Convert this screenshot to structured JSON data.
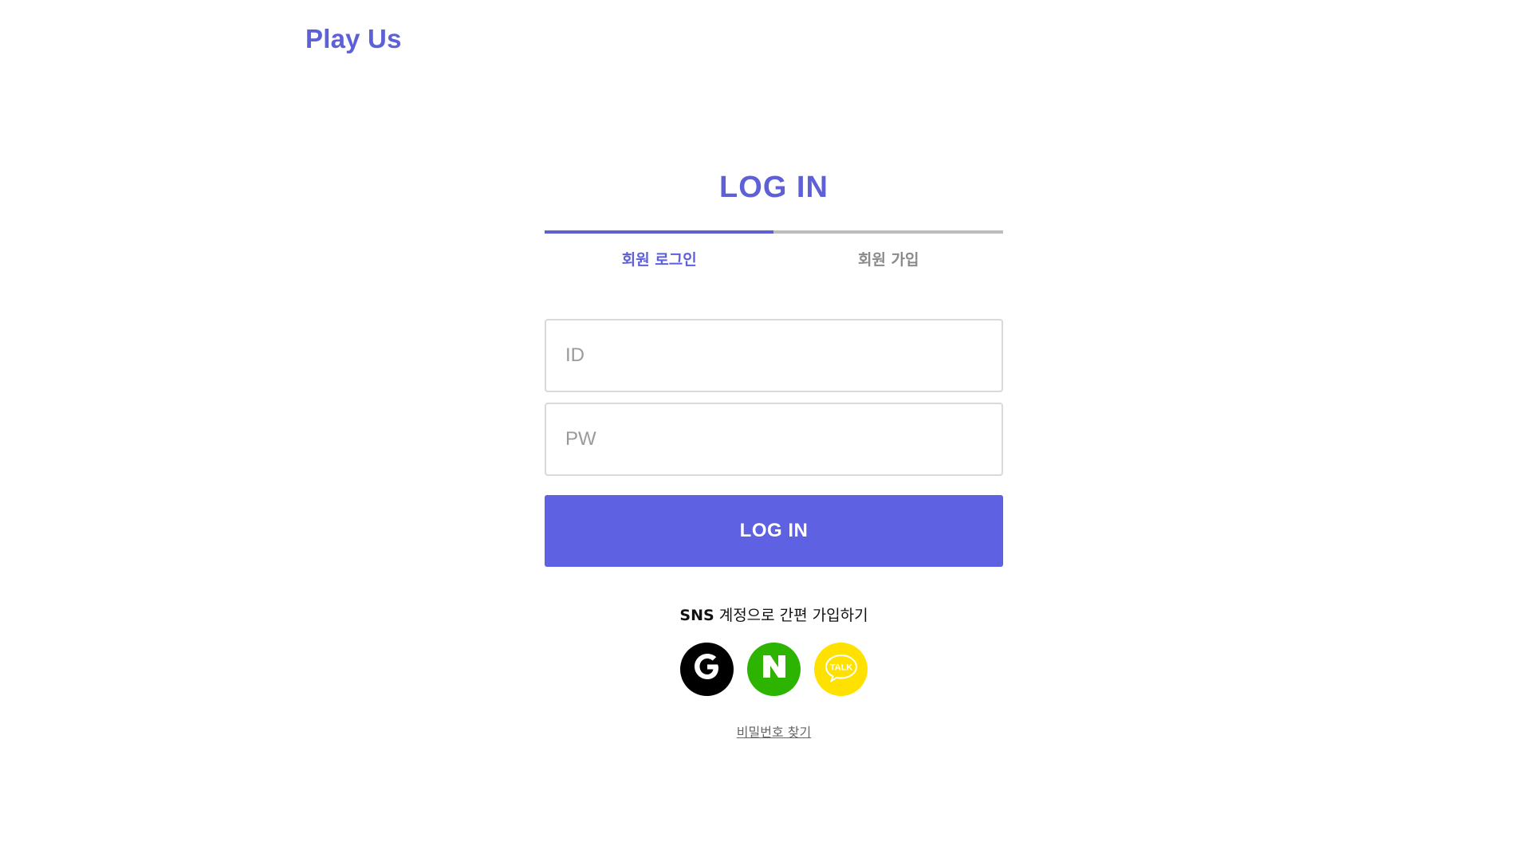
{
  "header": {
    "logo_text": "Play Us"
  },
  "login": {
    "title": "LOG IN",
    "tabs": [
      {
        "label": "회원 로그인",
        "active": true
      },
      {
        "label": "회원 가입",
        "active": false
      }
    ],
    "id_placeholder": "ID",
    "pw_placeholder": "PW",
    "submit_label": "LOG IN"
  },
  "sns": {
    "caption_prefix": "SNS",
    "caption_rest": " 계정으로 간편 가입하기",
    "providers": [
      {
        "icon": "google-icon",
        "color": "#000000"
      },
      {
        "icon": "naver-icon",
        "color": "#2db400"
      },
      {
        "icon": "kakaotalk-icon",
        "color": "#ffe100",
        "badge_text": "TALK"
      }
    ]
  },
  "footer": {
    "find_password_label": "비밀번호 찾기"
  },
  "colors": {
    "accent": "#5e60d8",
    "button": "#5e62e2",
    "tab_inactive_rail": "#bdbdbd"
  }
}
